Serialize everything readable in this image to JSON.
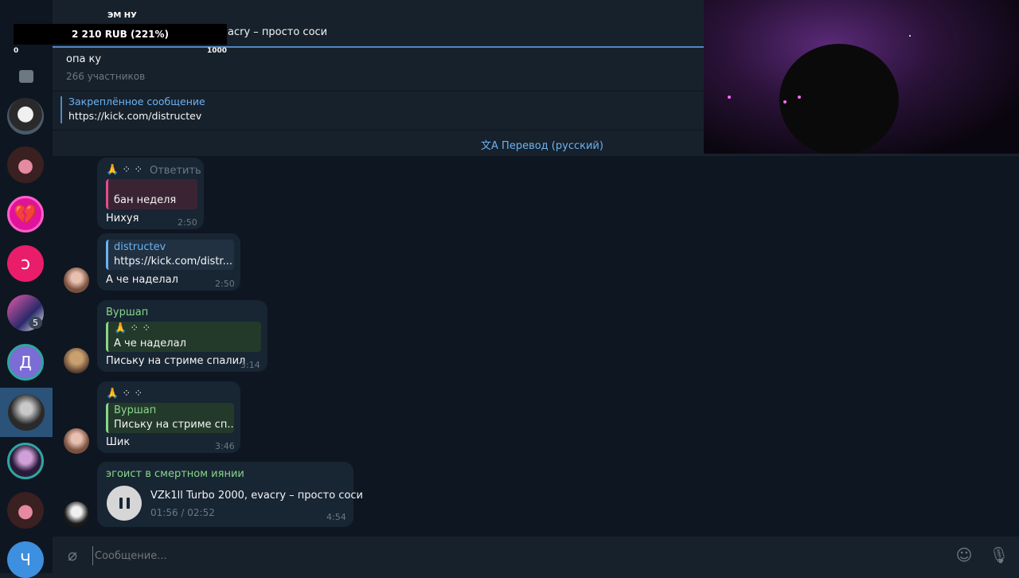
{
  "overlay": {
    "name": "ЭМ НУ",
    "donation": "2 210 RUB (221%)",
    "scale_min": "0",
    "scale_max": "1000"
  },
  "player": {
    "now_playing": "acry – просто соси"
  },
  "header": {
    "chat_title": "опа ку",
    "members": "266 участников"
  },
  "pinned": {
    "title": "Закреплённое сообщение",
    "text": "https://kick.com/distructev"
  },
  "translate": {
    "label": "Перевод (русский)"
  },
  "sidebar": {
    "unread_badge": "5",
    "letter_d": "Д",
    "letter_ch": "Ч"
  },
  "messages": [
    {
      "emoji": "🙏 ⁘ ⁘",
      "reply_action": "Ответить",
      "quote_text": "бан неделя",
      "text": "Нихуя",
      "time": "2:50"
    },
    {
      "quote_author": "distructev",
      "quote_text": "https://kick.com/distr...",
      "text": "А че наделал",
      "time": "2:50"
    },
    {
      "author": "Вуршап",
      "quote_emoji": "🙏 ⁘ ⁘",
      "quote_text": "А че наделал",
      "text": "Письку на стриме спалил",
      "time": "3:14"
    },
    {
      "emoji": "🙏 ⁘ ⁘",
      "quote_author": "Вуршап",
      "quote_text": "Письку на стриме сп...",
      "text": "Шик",
      "time": "3:46"
    },
    {
      "author": "эгоист в смертном иянии",
      "audio_title": "VZk1ll Turbo 2000, evacry – просто соси",
      "audio_progress": "01:56 / 02:52",
      "time": "4:54"
    }
  ],
  "composer": {
    "placeholder": "Сообщение..."
  },
  "colors": {
    "accent": "#5288c1",
    "link": "#6ab3f3",
    "author_green": "#88d68a",
    "reply_pink": "#e54b8c"
  }
}
